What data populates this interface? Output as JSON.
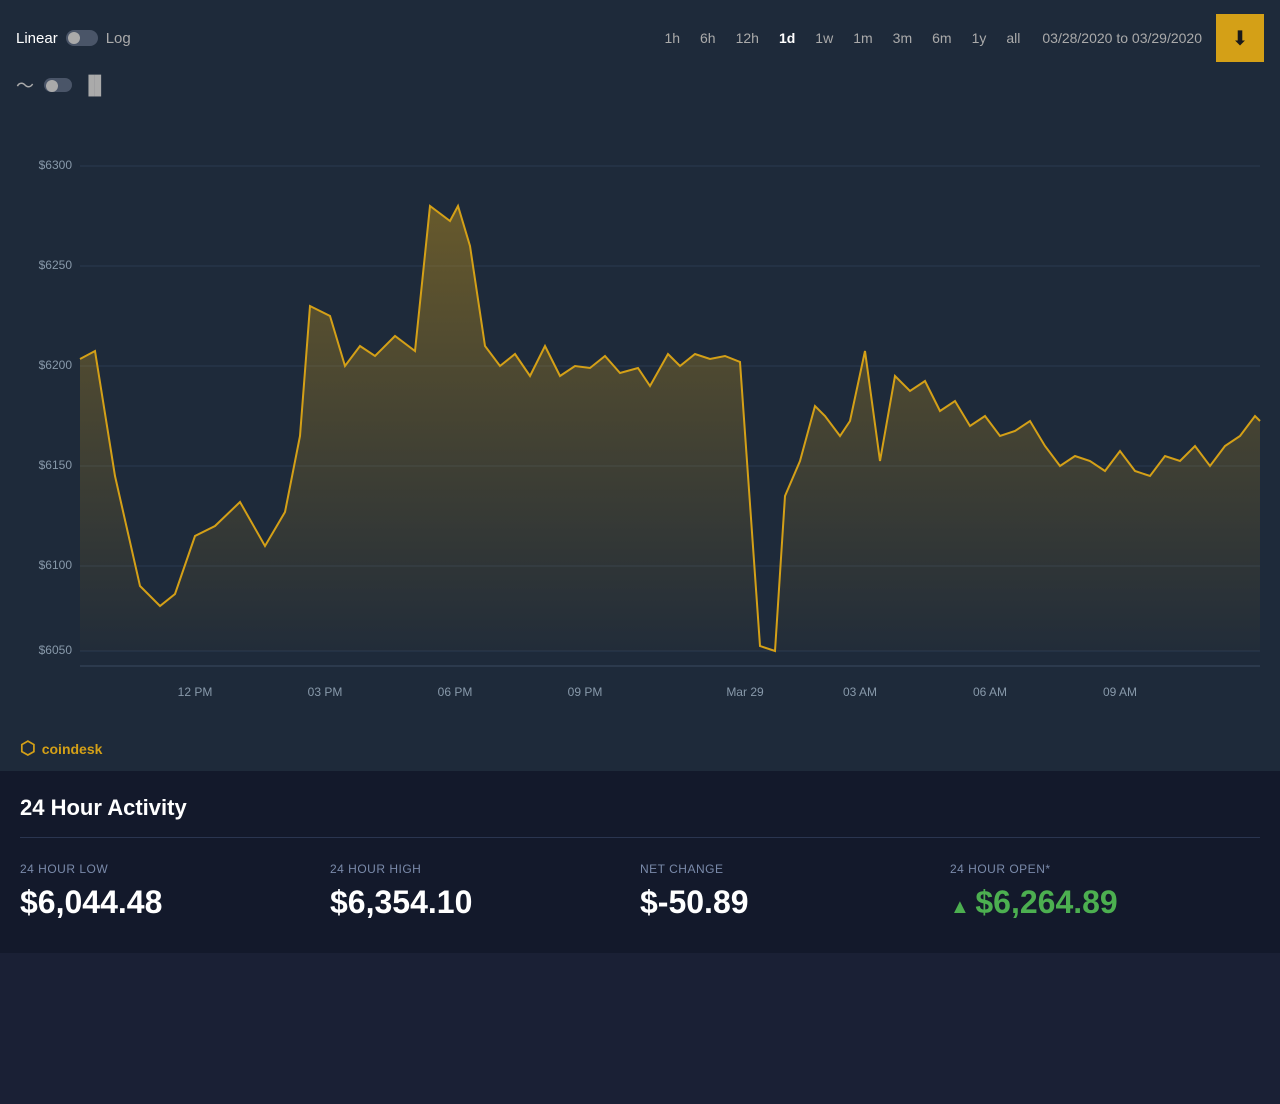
{
  "toolbar": {
    "linear_label": "Linear",
    "log_label": "Log",
    "chart_type_toggle": false,
    "time_buttons": [
      "1h",
      "6h",
      "12h",
      "1d",
      "1w",
      "1m",
      "3m",
      "6m",
      "1y",
      "all"
    ],
    "active_time": "1d",
    "date_from": "03/28/2020",
    "date_to_label": "to",
    "date_to": "03/29/2020",
    "download_icon": "⬇"
  },
  "chart": {
    "y_labels": [
      "$6300",
      "$6250",
      "$6200",
      "$6150",
      "$6100",
      "$6050"
    ],
    "x_labels": [
      "12 PM",
      "03 PM",
      "06 PM",
      "09 PM",
      "Mar 29",
      "03 AM",
      "06 AM",
      "09 AM"
    ],
    "accent_color": "#d4a017"
  },
  "coindesk": {
    "logo_text": "coindesk"
  },
  "activity": {
    "title": "24 Hour Activity",
    "stats": [
      {
        "label": "24 HOUR LOW",
        "value": "$6,044.48",
        "type": "normal"
      },
      {
        "label": "24 HOUR HIGH",
        "value": "$6,354.10",
        "type": "normal"
      },
      {
        "label": "NET CHANGE",
        "value": "$-50.89",
        "type": "normal"
      },
      {
        "label": "24 HOUR OPEN*",
        "value": "$6,264.89",
        "type": "positive"
      }
    ]
  }
}
